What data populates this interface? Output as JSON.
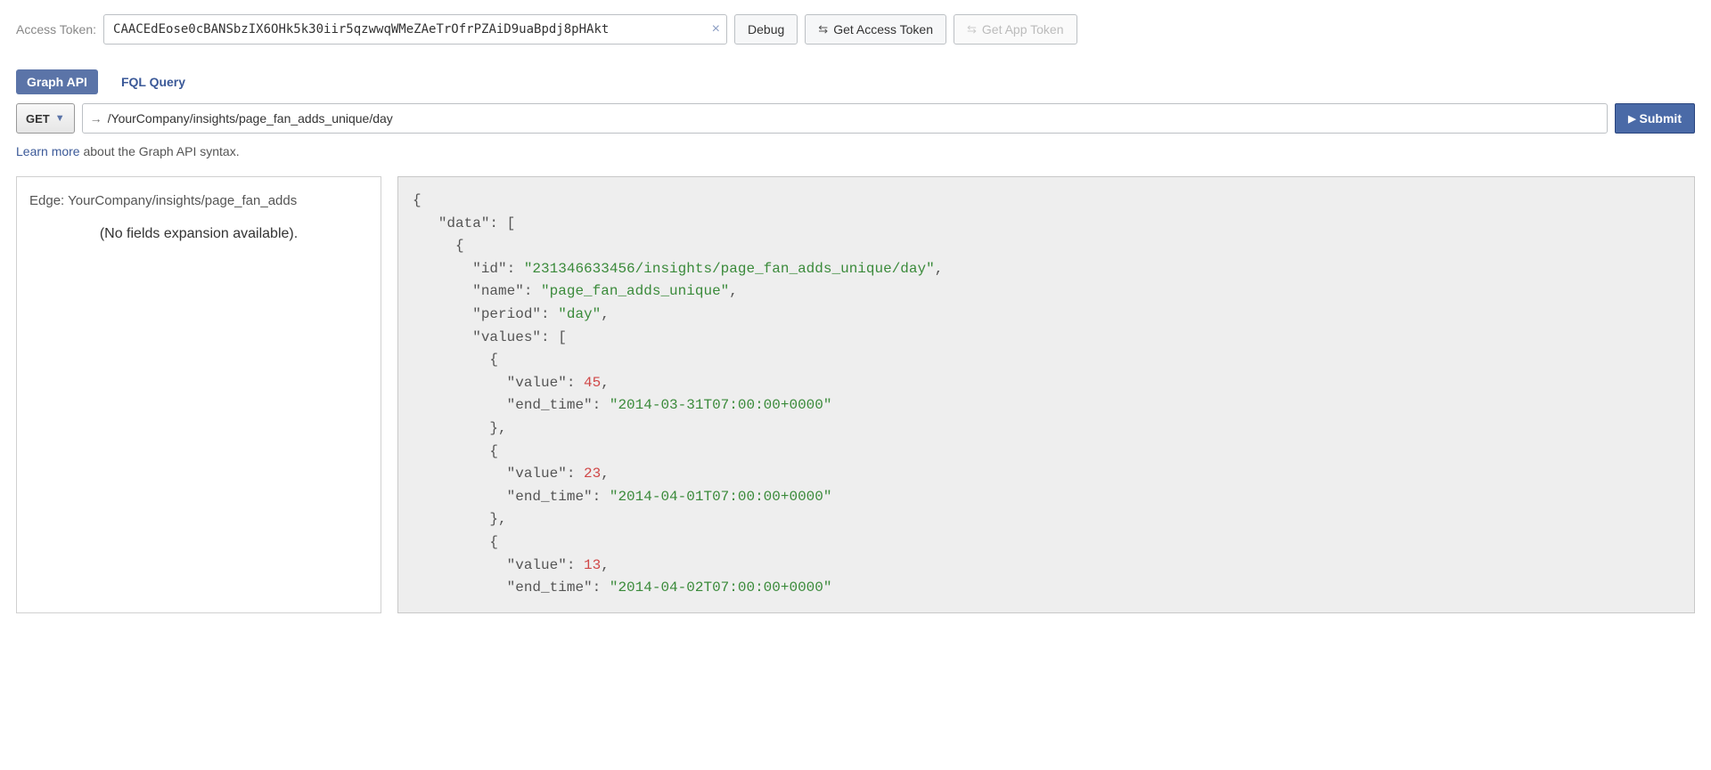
{
  "token_row": {
    "label": "Access Token:",
    "value": "CAACEdEose0cBANSbzIX6OHk5k30iir5qzwwqWMeZAeTrOfrPZAiD9uaBpdj8pHAkt",
    "clear_icon": "×",
    "debug_label": "Debug",
    "get_access_label": "Get Access Token",
    "get_app_label": "Get App Token",
    "swap_glyph": "⇆"
  },
  "tabs": {
    "graph": "Graph API",
    "fql": "FQL Query"
  },
  "request": {
    "method": "GET",
    "caret": "▼",
    "arrow": "→",
    "path": "/YourCompany/insights/page_fan_adds_unique/day",
    "submit": "Submit",
    "submit_tri": "▶"
  },
  "learn": {
    "link": "Learn more",
    "rest": " about the Graph API syntax."
  },
  "sidebar": {
    "edge_prefix": "Edge: ",
    "edge_value": "YourCompany/insights/page_fan_adds",
    "no_fields": "(No fields expansion available)."
  },
  "response": {
    "keys": {
      "data": "data",
      "id": "id",
      "name": "name",
      "period": "period",
      "values": "values",
      "value": "value",
      "end_time": "end_time"
    },
    "record": {
      "id": "231346633456/insights/page_fan_adds_unique/day",
      "name": "page_fan_adds_unique",
      "period": "day",
      "values": [
        {
          "value": 45,
          "end_time": "2014-03-31T07:00:00+0000"
        },
        {
          "value": 23,
          "end_time": "2014-04-01T07:00:00+0000"
        },
        {
          "value": 13,
          "end_time": "2014-04-02T07:00:00+0000"
        }
      ]
    }
  }
}
